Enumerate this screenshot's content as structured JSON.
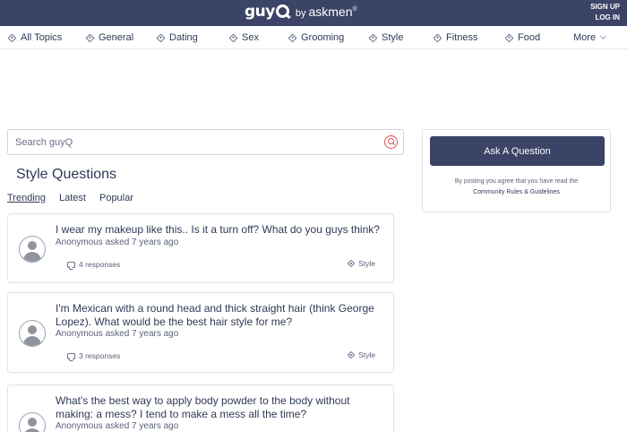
{
  "header": {
    "logo_main": "guy",
    "logo_by": "by",
    "logo_brand": "askmen",
    "logo_reg": "®",
    "sign_up": "SIGN UP",
    "log_in": "LOG IN"
  },
  "nav": {
    "items": [
      {
        "label": "All Topics",
        "icon": "tag-icon"
      },
      {
        "label": "General",
        "icon": "tag-icon"
      },
      {
        "label": "Dating",
        "icon": "tag-icon"
      },
      {
        "label": "Sex",
        "icon": "tag-icon"
      },
      {
        "label": "Grooming",
        "icon": "tag-icon"
      },
      {
        "label": "Style",
        "icon": "tag-icon"
      },
      {
        "label": "Fitness",
        "icon": "tag-icon"
      },
      {
        "label": "Food",
        "icon": "tag-icon"
      }
    ],
    "more_label": "More"
  },
  "search": {
    "placeholder": "Search guyQ"
  },
  "page": {
    "title": "Style Questions",
    "tabs": [
      "Trending",
      "Latest",
      "Popular"
    ],
    "active_tab": "Trending"
  },
  "questions": [
    {
      "title": "I wear my makeup like this.. Is it a turn off? What do you guys think?",
      "meta": "Anonymous asked 7 years ago",
      "responses": "4 responses",
      "tag": "Style"
    },
    {
      "title": "I'm Mexican with a round head and thick straight hair (think George Lopez). What would be the best hair style for me?",
      "meta": "Anonymous asked 7 years ago",
      "responses": "3 responses",
      "tag": "Style"
    },
    {
      "title": "What's the best way to apply body powder to the body without making: a mess? I tend to make a mess all the time?",
      "meta": "Anonymous asked 7 years ago"
    }
  ],
  "ask": {
    "button_label": "Ask A Question",
    "note": "By posting you agree that you have read the",
    "rules_link": "Community Rules & Guidelines"
  },
  "colors": {
    "brand_navy": "#3b4366",
    "text": "#2f3a57",
    "search_accent": "#d9534f",
    "border": "#dfe2e8"
  }
}
